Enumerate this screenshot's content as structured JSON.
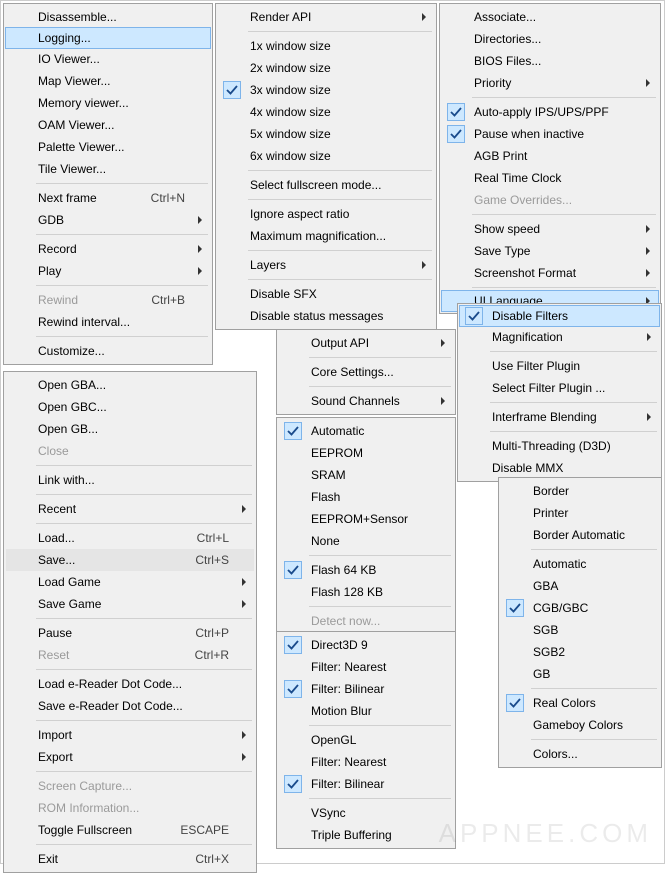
{
  "watermark": "APPNEE.COM",
  "menu1": {
    "items": [
      {
        "label": "Disassemble..."
      },
      {
        "label": "Logging...",
        "hover": true
      },
      {
        "label": "IO Viewer..."
      },
      {
        "label": "Map Viewer..."
      },
      {
        "label": "Memory viewer..."
      },
      {
        "label": "OAM Viewer..."
      },
      {
        "label": "Palette Viewer..."
      },
      {
        "label": "Tile Viewer..."
      },
      {
        "sep": true
      },
      {
        "label": "Next frame",
        "shortcut": "Ctrl+N"
      },
      {
        "label": "GDB",
        "sub": true
      },
      {
        "sep": true
      },
      {
        "label": "Record",
        "sub": true
      },
      {
        "label": "Play",
        "sub": true
      },
      {
        "sep": true
      },
      {
        "label": "Rewind",
        "shortcut": "Ctrl+B",
        "disabled": true
      },
      {
        "label": "Rewind interval..."
      },
      {
        "sep": true
      },
      {
        "label": "Customize..."
      }
    ]
  },
  "menu2": {
    "items": [
      {
        "label": "Open GBA..."
      },
      {
        "label": "Open GBC..."
      },
      {
        "label": "Open GB..."
      },
      {
        "label": "Close",
        "disabled": true
      },
      {
        "sep": true
      },
      {
        "label": "Link with..."
      },
      {
        "sep": true
      },
      {
        "label": "Recent",
        "sub": true
      },
      {
        "sep": true
      },
      {
        "label": "Load...",
        "shortcut": "Ctrl+L"
      },
      {
        "label": "Save...",
        "shortcut": "Ctrl+S",
        "hover2": true
      },
      {
        "label": "Load Game",
        "sub": true
      },
      {
        "label": "Save Game",
        "sub": true
      },
      {
        "sep": true
      },
      {
        "label": "Pause",
        "shortcut": "Ctrl+P"
      },
      {
        "label": "Reset",
        "shortcut": "Ctrl+R",
        "disabled": true
      },
      {
        "sep": true
      },
      {
        "label": "Load e-Reader Dot Code..."
      },
      {
        "label": "Save e-Reader Dot Code..."
      },
      {
        "sep": true
      },
      {
        "label": "Import",
        "sub": true
      },
      {
        "label": "Export",
        "sub": true
      },
      {
        "sep": true
      },
      {
        "label": "Screen Capture...",
        "disabled": true
      },
      {
        "label": "ROM Information...",
        "disabled": true
      },
      {
        "label": "Toggle Fullscreen",
        "shortcut": "ESCAPE"
      },
      {
        "sep": true
      },
      {
        "label": "Exit",
        "shortcut": "Ctrl+X"
      }
    ]
  },
  "menu3": {
    "items": [
      {
        "label": "Render API",
        "sub": true
      },
      {
        "sep": true
      },
      {
        "label": "1x window size"
      },
      {
        "label": "2x window size"
      },
      {
        "label": "3x window size",
        "checked": true
      },
      {
        "label": "4x window size"
      },
      {
        "label": "5x window size"
      },
      {
        "label": "6x window size"
      },
      {
        "sep": true
      },
      {
        "label": "Select fullscreen mode..."
      },
      {
        "sep": true
      },
      {
        "label": "Ignore aspect ratio"
      },
      {
        "label": "Maximum magnification..."
      },
      {
        "sep": true
      },
      {
        "label": "Layers",
        "sub": true
      },
      {
        "sep": true
      },
      {
        "label": "Disable SFX"
      },
      {
        "label": "Disable status messages"
      }
    ]
  },
  "menu4": {
    "items": [
      {
        "label": "Output API",
        "sub": true
      },
      {
        "sep": true
      },
      {
        "label": "Core Settings..."
      },
      {
        "sep": true
      },
      {
        "label": "Sound Channels",
        "sub": true
      }
    ]
  },
  "menu5": {
    "items": [
      {
        "label": "Automatic",
        "checked": true
      },
      {
        "label": "EEPROM"
      },
      {
        "label": "SRAM"
      },
      {
        "label": "Flash"
      },
      {
        "label": "EEPROM+Sensor"
      },
      {
        "label": "None"
      },
      {
        "sep": true
      },
      {
        "label": "Flash 64 KB",
        "checked": true
      },
      {
        "label": "Flash 128 KB"
      },
      {
        "sep": true
      },
      {
        "label": "Detect now...",
        "disabled": true
      }
    ]
  },
  "menu6": {
    "items": [
      {
        "label": "Direct3D 9",
        "checked": true
      },
      {
        "label": "Filter: Nearest"
      },
      {
        "label": "Filter: Bilinear",
        "checked": true
      },
      {
        "label": "Motion Blur"
      },
      {
        "sep": true
      },
      {
        "label": "OpenGL"
      },
      {
        "label": "Filter: Nearest"
      },
      {
        "label": "Filter: Bilinear",
        "checked": true
      },
      {
        "sep": true
      },
      {
        "label": "VSync"
      },
      {
        "label": "Triple Buffering"
      }
    ]
  },
  "menu7": {
    "items": [
      {
        "label": "Associate..."
      },
      {
        "label": "Directories..."
      },
      {
        "label": "BIOS Files..."
      },
      {
        "label": "Priority",
        "sub": true
      },
      {
        "sep": true
      },
      {
        "label": "Auto-apply IPS/UPS/PPF",
        "checked": true
      },
      {
        "label": "Pause when inactive",
        "checked": true
      },
      {
        "label": "AGB Print"
      },
      {
        "label": "Real Time Clock"
      },
      {
        "label": "Game Overrides...",
        "disabled": true
      },
      {
        "sep": true
      },
      {
        "label": "Show speed",
        "sub": true
      },
      {
        "label": "Save Type",
        "sub": true
      },
      {
        "label": "Screenshot Format",
        "sub": true
      },
      {
        "sep": true
      },
      {
        "label": "UI Language",
        "sub": true,
        "hover": true
      }
    ]
  },
  "menu8": {
    "items": [
      {
        "label": "Disable Filters",
        "checked": true,
        "hover": true
      },
      {
        "label": "Magnification",
        "sub": true
      },
      {
        "sep": true
      },
      {
        "label": "Use Filter Plugin"
      },
      {
        "label": "Select Filter Plugin ..."
      },
      {
        "sep": true
      },
      {
        "label": "Interframe Blending",
        "sub": true
      },
      {
        "sep": true
      },
      {
        "label": "Multi-Threading (D3D)"
      },
      {
        "label": "Disable MMX"
      }
    ]
  },
  "menu9": {
    "items": [
      {
        "label": "Border"
      },
      {
        "label": "Printer"
      },
      {
        "label": "Border Automatic"
      },
      {
        "sep": true
      },
      {
        "label": "Automatic"
      },
      {
        "label": "GBA"
      },
      {
        "label": "CGB/GBC",
        "checked": true
      },
      {
        "label": "SGB"
      },
      {
        "label": "SGB2"
      },
      {
        "label": "GB"
      },
      {
        "sep": true
      },
      {
        "label": "Real Colors",
        "checked": true
      },
      {
        "label": "Gameboy Colors"
      },
      {
        "sep": true
      },
      {
        "label": "Colors..."
      }
    ]
  }
}
